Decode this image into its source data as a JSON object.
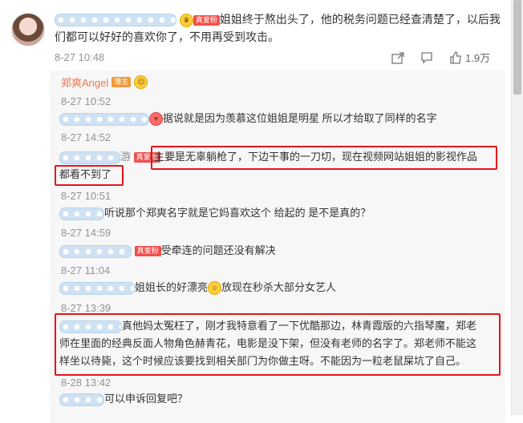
{
  "main_comment": {
    "badge": "真爱粉",
    "text_line1": "姐姐终于熬出头了，他的税务问题已经查清楚了，以后我",
    "text_line2": "们都可以好好的喜欢你了，不用再受到攻击。",
    "time": "8-27 10:48",
    "like_count": "1.9万"
  },
  "author": {
    "name": "郑爽Angel",
    "badge": "博主"
  },
  "replies": [
    {
      "time": "8-27 10:52",
      "text": "据说就是因为羡慕这位姐姐是明星 所以才给取了同样的名字"
    },
    {
      "time": "8-27 14:52",
      "user_fragment": "游",
      "badge": "真爱粉",
      "text_line1": "主要是无辜躺枪了，下边干事的一刀切，现在视频网站姐姐的影视作品",
      "text_line2": "都看不到了"
    },
    {
      "time": "8-27 10:51",
      "text": "听说那个郑爽名字就是它妈喜欢这个 给起的 是不是真的？"
    },
    {
      "time": "8-27 14:59",
      "badge": "真爱粉",
      "text": "受牵连的问题还没有解决"
    },
    {
      "time": "8-27 11:04",
      "text": "姐姐长的好漂亮",
      "text_after": "放现在秒杀大部分女艺人"
    },
    {
      "time": "8-27 13:39",
      "text_line1": "真他妈太冤枉了，刚才我特意看了一下优酷那边，林青霞版的六指琴魔，郑老",
      "text_line2": "师在里面的经典反面人物角色赫青花，电影是没下架，但没有老师的名字了。郑老师不能这",
      "text_line3": "样坐以待毙，这个时候应该要找到相关部门为你做主呀。不能因为一粒老鼠屎坑了自己。"
    },
    {
      "time": "8-28 13:42",
      "text": "可以申诉回复吧？"
    }
  ],
  "icons": [
    "share-icon",
    "comment-icon",
    "like-icon"
  ],
  "colors": {
    "highlight_box": "#e5141a",
    "author_name": "#eb7350",
    "badge_red": "#f0504e",
    "time_gray": "#939393"
  }
}
